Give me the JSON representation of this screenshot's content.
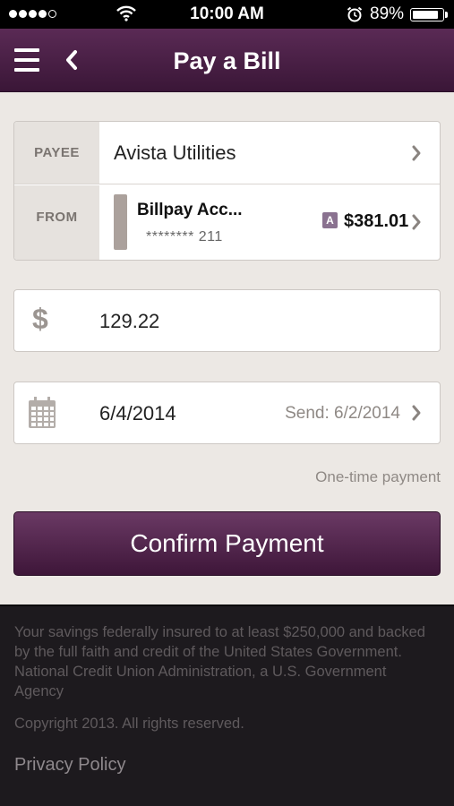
{
  "status_bar": {
    "time": "10:00 AM",
    "battery_percent": "89%",
    "battery_level": 0.89,
    "signal_bars_filled": 4,
    "signal_bars_total": 5
  },
  "nav": {
    "title": "Pay a Bill",
    "menu_icon": "hamburger-menu-icon",
    "back_icon": "chevron-left-icon"
  },
  "payment_form": {
    "payee": {
      "label": "PAYEE",
      "value": "Avista Utilities"
    },
    "from": {
      "label": "FROM",
      "account_name": "Billpay Acc...",
      "account_number": "******** 211",
      "account_badge": "A",
      "balance": "$381.01",
      "swatch_color": "#aba19c"
    },
    "amount": {
      "currency_symbol": "$",
      "value": "129.22"
    },
    "date": {
      "value": "6/4/2014",
      "send_date": "Send: 6/2/2014"
    },
    "frequency": "One-time payment",
    "confirm_label": "Confirm Payment"
  },
  "footer": {
    "disclaimer": "Your savings federally insured to at least $250,000 and backed by the full faith and credit of the United States Government. National Credit Union Administration, a U.S. Government Agency",
    "copyright": "Copyright 2013. All rights reserved.",
    "privacy_link": "Privacy Policy"
  },
  "colors": {
    "brand": "#4a1f45",
    "background": "#ece8e4",
    "footer": "#1d1a1e"
  }
}
